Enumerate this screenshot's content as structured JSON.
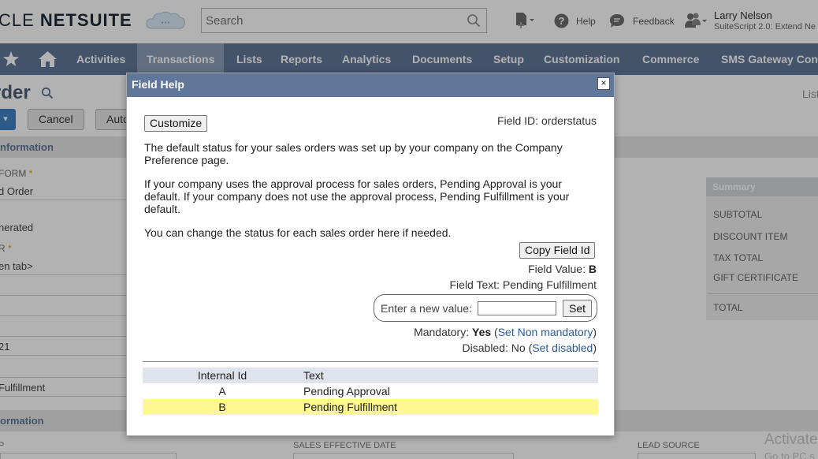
{
  "background": {
    "logo": {
      "part1": "CLE",
      "part2": "NETSUITE"
    },
    "search": {
      "placeholder": "Search"
    },
    "toolbar": {
      "help": "Help",
      "feedback": "Feedback"
    },
    "user": {
      "name": "Larry Nelson",
      "role": "SuiteScript 2.0: Extend Ne"
    },
    "nav": [
      "Activities",
      "Transactions",
      "Lists",
      "Reports",
      "Analytics",
      "Documents",
      "Setup",
      "Customization",
      "Commerce",
      "SMS Gateway Con"
    ],
    "nav_active": "Transactions",
    "page_title": "rder",
    "list_link": "List",
    "buttons": {
      "cancel": "Cancel",
      "auto": "Auto",
      "dropdown": "▾"
    },
    "sections": {
      "primary": "nformation",
      "secondary": "ormation"
    },
    "fields": [
      {
        "label": "FORM",
        "required": true,
        "value": "d Order"
      },
      {
        "label": "",
        "required": false,
        "value": "nerated"
      },
      {
        "label": "R",
        "required": true,
        "value": "en tab>"
      },
      {
        "label": "",
        "required": false,
        "value": "21"
      },
      {
        "label": "",
        "required": false,
        "value": "Fulfillment"
      }
    ],
    "summary": {
      "title": "Summary",
      "rows": [
        "SUBTOTAL",
        "DISCOUNT ITEM",
        "TAX TOTAL",
        "GIFT CERTIFICATE",
        "TOTAL"
      ]
    },
    "bottom_labels": {
      "left": "P",
      "sales_effective_date": "SALES EFFECTIVE DATE",
      "lead_source": "LEAD SOURCE"
    },
    "watermark": {
      "line1": "Activate",
      "line2": "Go to PC s"
    }
  },
  "modal": {
    "title": "Field Help",
    "close_label": "×",
    "customize_label": "Customize",
    "field_id_text": "Field ID: orderstatus",
    "paragraphs": [
      "The default status for your sales orders was set up by your company on the Company Preference page.",
      "If your company uses the approval process for sales orders, Pending Approval is your default. If your company does not use the approval process, Pending Fulfillment is your default.",
      "You can change the status for each sales order here if needed."
    ],
    "copy_field_id_label": "Copy Field Id",
    "field_value_label": "Field Value:",
    "field_value": "B",
    "field_text": "Field Text: Pending Fulfillment",
    "new_value_label": "Enter a new value:",
    "new_value": "",
    "set_label": "Set",
    "mandatory_label": "Mandatory:",
    "mandatory_value": "Yes",
    "set_non_mandatory": "Set Non mandatory",
    "disabled_label": "Disabled:",
    "disabled_value": "No",
    "set_disabled": "Set disabled",
    "table": {
      "headers": [
        "Internal Id",
        "Text"
      ],
      "rows": [
        {
          "id": "A",
          "text": "Pending Approval",
          "highlighted": false
        },
        {
          "id": "B",
          "text": "Pending Fulfillment",
          "highlighted": true
        }
      ]
    }
  }
}
